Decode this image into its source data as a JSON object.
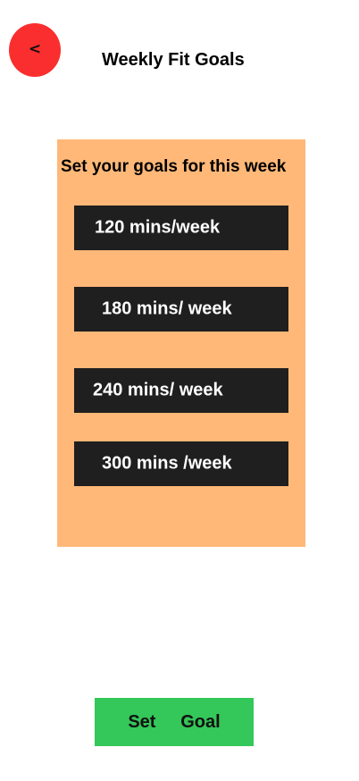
{
  "header": {
    "back_label": "<",
    "title": "Weekly Fit Goals"
  },
  "panel": {
    "heading": "Set your goals for this week",
    "options": [
      {
        "label": "120 mins/week"
      },
      {
        "label": "180 mins/ week"
      },
      {
        "label": "240 mins/ week"
      },
      {
        "label": "300 mins /week"
      }
    ]
  },
  "footer": {
    "set_goal_label": "Set     Goal"
  },
  "colors": {
    "back_button": "#fa2e2e",
    "panel_bg": "#ffb878",
    "option_bg": "#1f1f1f",
    "set_goal_bg": "#34c759"
  }
}
